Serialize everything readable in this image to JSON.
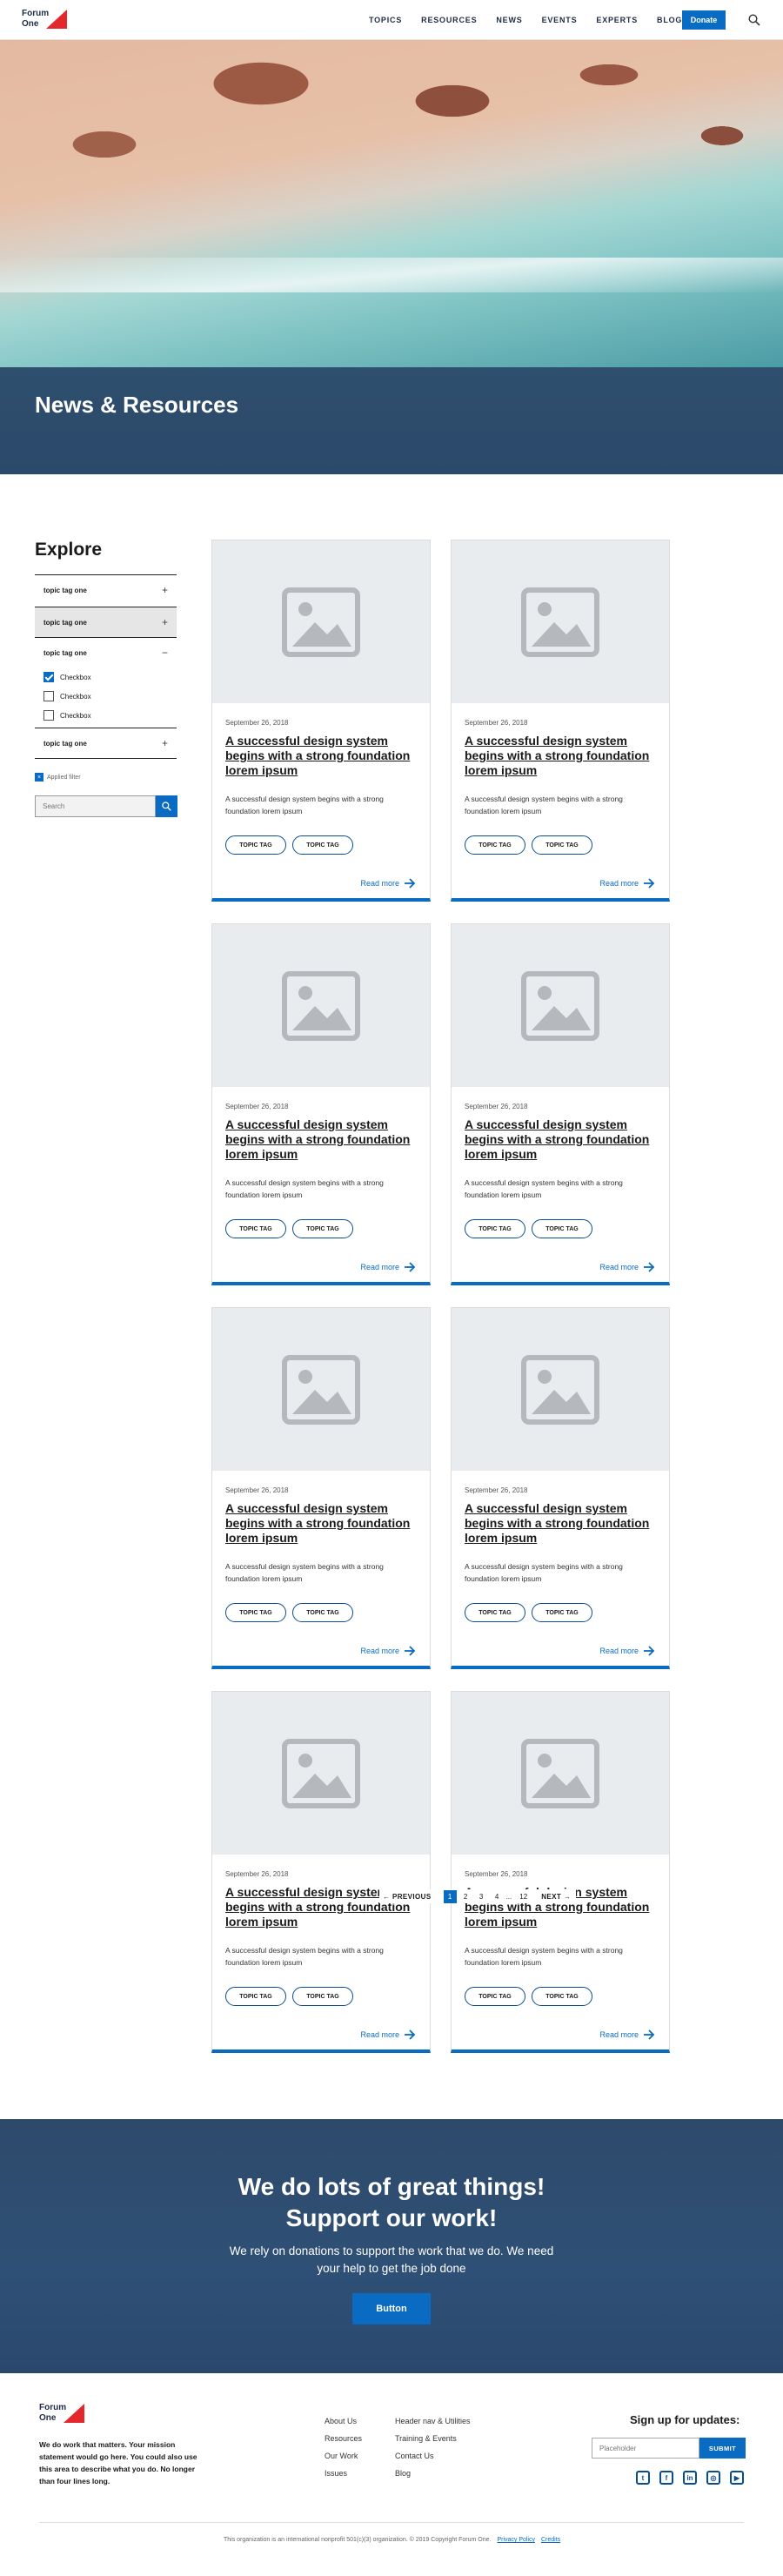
{
  "header": {
    "logo_line1": "Forum",
    "logo_line2": "One",
    "nav": [
      "TOPICS",
      "RESOURCES",
      "NEWS",
      "EVENTS",
      "EXPERTS",
      "BLOG"
    ],
    "donate_label": "Donate",
    "search_icon": "search-icon"
  },
  "hero": {
    "title": "News & Resources"
  },
  "sidebar": {
    "title": "Explore",
    "facets": [
      {
        "label": "topic tag one",
        "toggle": "+"
      },
      {
        "label": "topic tag one",
        "toggle": "+"
      },
      {
        "label": "topic tag one",
        "toggle": "−"
      },
      {
        "label": "topic tag one",
        "toggle": "+"
      }
    ],
    "checkboxes": [
      {
        "label": "Checkbox",
        "checked": true
      },
      {
        "label": "Checkbox",
        "checked": false
      },
      {
        "label": "Checkbox",
        "checked": false
      }
    ],
    "applied_filter": "Applied filter",
    "applied_icon": "close-icon",
    "search_placeholder": "Search"
  },
  "cards": [
    {
      "date": "September 26, 2018",
      "title": "A successful design system begins with a strong foundation lorem ipsum",
      "desc": "A successful design system begins with a strong foundation lorem ipsum",
      "tags": [
        "TOPIC TAG",
        "TOPIC TAG"
      ],
      "more": "Read more"
    },
    {
      "date": "September 26, 2018",
      "title": "A successful design system begins with a strong foundation lorem ipsum",
      "desc": "A successful design system begins with a strong foundation lorem ipsum",
      "tags": [
        "TOPIC TAG",
        "TOPIC TAG"
      ],
      "more": "Read more"
    },
    {
      "date": "September 26, 2018",
      "title": "A successful design system begins with a strong foundation lorem ipsum",
      "desc": "A successful design system begins with a strong foundation lorem ipsum",
      "tags": [
        "TOPIC TAG",
        "TOPIC TAG"
      ],
      "more": "Read more"
    },
    {
      "date": "September 26, 2018",
      "title": "A successful design system begins with a strong foundation lorem ipsum",
      "desc": "A successful design system begins with a strong foundation lorem ipsum",
      "tags": [
        "TOPIC TAG",
        "TOPIC TAG"
      ],
      "more": "Read more"
    },
    {
      "date": "September 26, 2018",
      "title": "A successful design system begins with a strong foundation lorem ipsum",
      "desc": "A successful design system begins with a strong foundation lorem ipsum",
      "tags": [
        "TOPIC TAG",
        "TOPIC TAG"
      ],
      "more": "Read more"
    },
    {
      "date": "September 26, 2018",
      "title": "A successful design system begins with a strong foundation lorem ipsum",
      "desc": "A successful design system begins with a strong foundation lorem ipsum",
      "tags": [
        "TOPIC TAG",
        "TOPIC TAG"
      ],
      "more": "Read more"
    },
    {
      "date": "September 26, 2018",
      "title": "A successful design system begins with a strong foundation lorem ipsum",
      "desc": "A successful design system begins with a strong foundation lorem ipsum",
      "tags": [
        "TOPIC TAG",
        "TOPIC TAG"
      ],
      "more": "Read more"
    },
    {
      "date": "September 26, 2018",
      "title": "A successful design system begins with a strong foundation lorem ipsum",
      "desc": "A successful design system begins with a strong foundation lorem ipsum",
      "tags": [
        "TOPIC TAG",
        "TOPIC TAG"
      ],
      "more": "Read more"
    }
  ],
  "pagination": {
    "prev": "← PREVIOUS",
    "pages": [
      "1",
      "2",
      "3",
      "4"
    ],
    "ellipsis": "...",
    "last": "12",
    "next": "NEXT →",
    "current": "1"
  },
  "support": {
    "title_line1": "We do lots of great things!",
    "title_line2": "Support our work!",
    "text": "We rely on donations to support the work that we do. We need your help to get the job done",
    "button": "Button"
  },
  "footer": {
    "logo_line1": "Forum",
    "logo_line2": "One",
    "mission": "We do work that matters. Your mission statement would go here. You could also use this area to describe what you do. No longer than four lines long.",
    "col1": [
      "About Us",
      "Resources",
      "Our Work",
      "Issues"
    ],
    "col2": [
      "Header nav & Utilities",
      "Training & Events",
      "Contact Us",
      "Blog"
    ],
    "signup_title": "Sign up for updates:",
    "signup_placeholder": "Placeholder",
    "signup_button": "SUBMIT",
    "social": [
      {
        "icon": "twitter-icon",
        "glyph": "t"
      },
      {
        "icon": "facebook-icon",
        "glyph": "f"
      },
      {
        "icon": "linkedin-icon",
        "glyph": "in"
      },
      {
        "icon": "instagram-icon",
        "glyph": "◎"
      },
      {
        "icon": "youtube-icon",
        "glyph": "▶"
      }
    ],
    "legal": "This organization is an international nonprofit 501(c)(3) organization.    © 2019 Copyright Forum One.",
    "privacy": "Privacy Policy",
    "credits": "Credits"
  },
  "colors": {
    "accent": "#0a6bc2",
    "brand_red": "#e4272d",
    "navy": "#2d4a6a"
  }
}
